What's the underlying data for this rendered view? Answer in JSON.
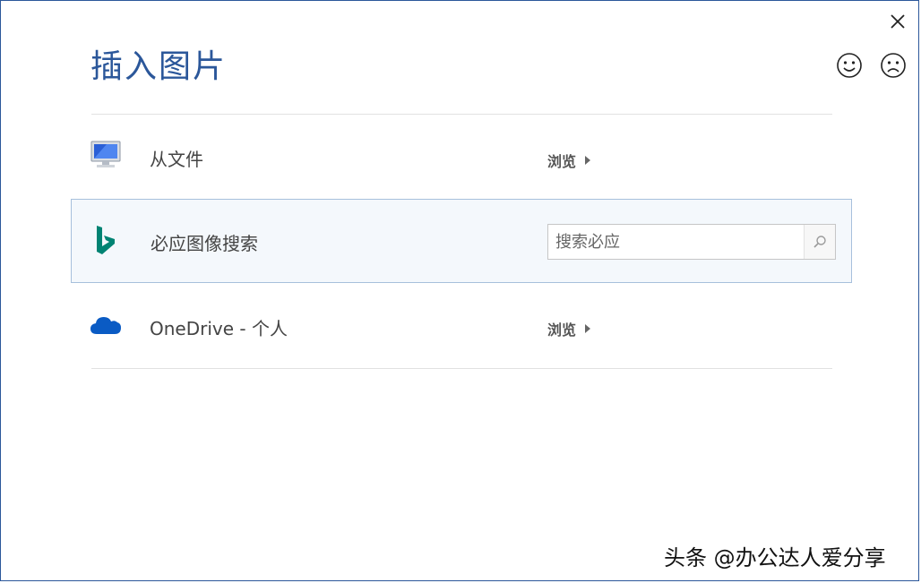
{
  "dialog": {
    "title": "插入图片",
    "close_icon": "close-icon",
    "feedback": {
      "smile_icon": "smile-icon",
      "frown_icon": "frown-icon"
    }
  },
  "sources": [
    {
      "label": "从文件",
      "icon": "computer-icon",
      "action_label": "浏览"
    },
    {
      "label": "必应图像搜索",
      "icon": "bing-icon",
      "search_placeholder": "搜索必应",
      "search_icon": "search-icon"
    },
    {
      "label": "OneDrive - 个人",
      "icon": "onedrive-icon",
      "action_label": "浏览"
    }
  ],
  "watermark": "头条 @办公达人爱分享",
  "colors": {
    "accent": "#2b579a",
    "bing": "#008373",
    "onedrive": "#0a5bc4",
    "selected_row_bg": "#f4f8fc",
    "selected_row_border": "#a7c0dc"
  }
}
